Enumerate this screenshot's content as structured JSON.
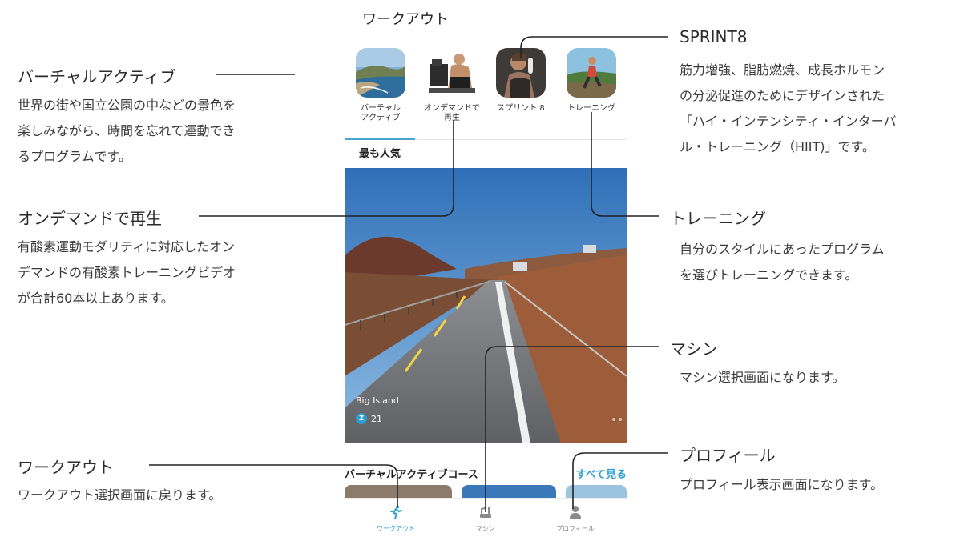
{
  "screen": {
    "title": "ワークアウト",
    "categories": [
      {
        "label": "バーチャル\nアクティブ",
        "icon": "virtual-active-thumbnail"
      },
      {
        "label": "オンデマンドで\n再生",
        "icon": "on-demand-thumbnail"
      },
      {
        "label": "スプリント 8",
        "icon": "sprint8-thumbnail"
      },
      {
        "label": "トレーニング",
        "icon": "training-thumbnail"
      }
    ],
    "popular_label": "最も人気",
    "hero": {
      "name": "Big Island",
      "badge": "Z",
      "count": "21"
    },
    "section_title": "バーチャルアクティブコース",
    "see_all": "すべて見る",
    "bottom_nav": [
      {
        "label": "ワークアウト",
        "icon": "runner-icon",
        "active": true
      },
      {
        "label": "マシン",
        "icon": "machine-icon",
        "active": false
      },
      {
        "label": "プロフィール",
        "icon": "person-icon",
        "active": false
      }
    ]
  },
  "annotations": {
    "virtual_active": {
      "title": "バーチャルアクティブ",
      "lines": [
        "世界の街や国立公園の中などの景色を",
        "楽しみながら、時間を忘れて運動でき",
        "るプログラムです。"
      ]
    },
    "on_demand": {
      "title": "オンデマンドで再生",
      "lines": [
        "有酸素運動モダリティに対応したオン",
        "デマンドの有酸素トレーニングビデオ",
        "が合計60本以上あります。"
      ]
    },
    "workout": {
      "title": "ワークアウト",
      "lines": [
        "ワークアウト選択画面に戻ります。"
      ]
    },
    "sprint8": {
      "title": "SPRINT8",
      "lines": [
        "筋力増強、脂肪燃焼、成長ホルモン",
        "の分泌促進のためにデザインされた",
        "「ハイ・インテンシティ・インターバ",
        "ル・トレーニング（HIIT)」です。"
      ]
    },
    "training": {
      "title": "トレーニング",
      "lines": [
        "自分のスタイルにあったプログラム",
        "を選びトレーニングできます。"
      ]
    },
    "machine": {
      "title": "マシン",
      "lines": [
        "マシン選択画面になります。"
      ]
    },
    "profile": {
      "title": "プロフィール",
      "lines": [
        "プロフィール表示画面になります。"
      ]
    }
  },
  "colors": {
    "accent": "#2f9fd4",
    "line": "#222222"
  }
}
